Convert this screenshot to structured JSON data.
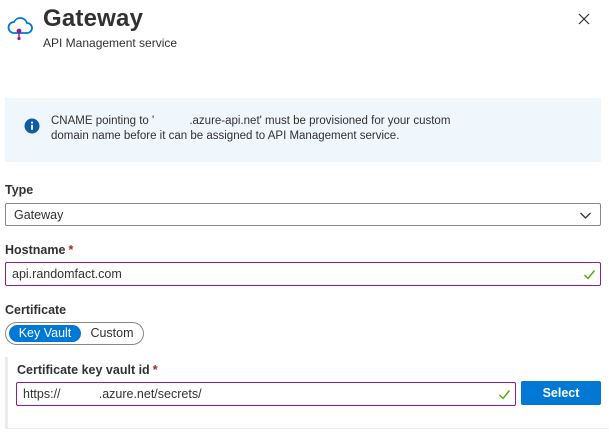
{
  "header": {
    "title": "Gateway",
    "subtitle": "API Management service",
    "icon": "cloud-gateway-icon",
    "close_icon": "close-icon"
  },
  "info_banner": {
    "icon": "info-icon",
    "line1": "CNAME pointing to '           .azure-api.net' must be provisioned for your custom",
    "line2": "domain name before it can be assigned to API Management service."
  },
  "type_field": {
    "label": "Type",
    "value": "Gateway",
    "icon": "chevron-down-icon"
  },
  "hostname_field": {
    "label": "Hostname",
    "required_mark": "*",
    "value": "api.randomfact.com",
    "status_icon": "checkmark-icon"
  },
  "certificate": {
    "label": "Certificate",
    "options": [
      "Key Vault",
      "Custom"
    ],
    "selected": "Key Vault"
  },
  "key_vault": {
    "label": "Certificate key vault id",
    "required_mark": "*",
    "value": "https://           .azure.net/secrets/",
    "status_icon": "checkmark-icon",
    "select_label": "Select"
  },
  "colors": {
    "accent": "#0078d4",
    "required": "#a4262c",
    "valid_input_border": "#8c1e8e",
    "valid_check": "#57a300",
    "info_background": "#eff6fc"
  }
}
